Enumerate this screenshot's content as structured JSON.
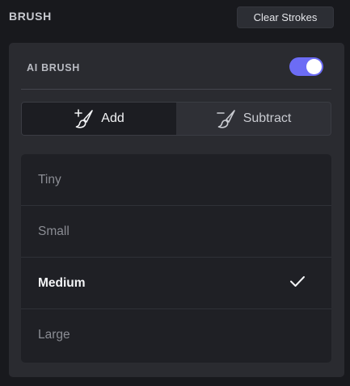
{
  "header": {
    "title": "BRUSH",
    "clear_label": "Clear Strokes"
  },
  "ai_brush": {
    "label": "AI BRUSH",
    "enabled": true,
    "toggle_color": "#6c6cf5"
  },
  "mode": {
    "options": [
      {
        "label": "Add",
        "icon": "brush-add-icon",
        "active": true
      },
      {
        "label": "Subtract",
        "icon": "brush-subtract-icon",
        "active": false
      }
    ]
  },
  "sizes": {
    "items": [
      {
        "label": "Tiny",
        "selected": false
      },
      {
        "label": "Small",
        "selected": false
      },
      {
        "label": "Medium",
        "selected": true
      },
      {
        "label": "Large",
        "selected": false
      }
    ],
    "selected_icon": "checkmark-icon"
  }
}
